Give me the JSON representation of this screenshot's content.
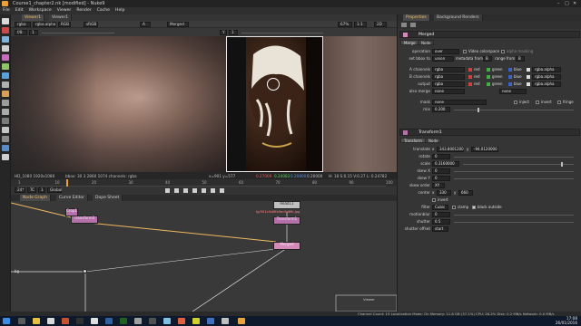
{
  "window": {
    "title": "Course1_chapter2.nk [modified] - Nuke9",
    "controls": [
      "–",
      "□",
      "✕"
    ]
  },
  "menu": [
    "File",
    "Edit",
    "Workspace",
    "Viewer",
    "Render",
    "Cache",
    "Help"
  ],
  "viewer": {
    "tabs": [
      "Viewer1",
      "Viewer1"
    ],
    "toolbar": {
      "channels": "rgba",
      "layer": "rgba.alpha",
      "display": "RGB",
      "lut": "sRGB",
      "input_a": "A",
      "input_b": "Merged",
      "zoom": "67%",
      "proxy": "1:1",
      "mode": "2D"
    },
    "toolbar2": {
      "exposure_f": "f/8",
      "exposure_val": "1",
      "gamma_y": "Y",
      "gamma_val": "1"
    },
    "info": {
      "format": "HD_1080  1920x1080",
      "bbox": "bbox: 30 3 2860 1074 channels: rgba",
      "coords": "x=901 y=577",
      "values": [
        "0.27009",
        "0.24083",
        "0.20800",
        "0.20000"
      ],
      "hsvl": "H: 18 S:0.15 V:0.27  L: 0.24782"
    },
    "timeline": {
      "ticks": [
        "1",
        "10",
        "20",
        "30",
        "40",
        "50",
        "60",
        "70",
        "80",
        "90",
        "100"
      ],
      "fps": "24*",
      "mode": "TC",
      "frame": "1",
      "scope": "Global",
      "playback_progress": 0.13
    }
  },
  "nodegraph": {
    "tabs": [
      "Node Graph",
      "Curve Editor",
      "Dope Sheet"
    ],
    "nodes": [
      {
        "name": "Read11",
        "file": "fg/501c0s6ffa9ec9d6fb.jpg",
        "color": "#c0c0c0"
      },
      {
        "name": "Transform1",
        "color": "#b470a8"
      },
      {
        "name": "Transform3",
        "color": "#b470a8"
      },
      {
        "name": "Merged",
        "color": "#d48ab8"
      },
      {
        "name": "Crop1",
        "color": "#b470a8"
      },
      {
        "name": "bg",
        "color": "#9a9a9a"
      },
      {
        "name": "Viewer",
        "color": "#888888"
      }
    ]
  },
  "properties": {
    "tabs": [
      "Properties",
      "Background Renders"
    ],
    "merged": {
      "name": "Merged",
      "subtabs": [
        "Merge",
        "Node"
      ],
      "operation_label": "operation",
      "operation": "over",
      "video_colorspace": "Video colorspace",
      "alpha_masking": "alpha masking",
      "set_bbox_label": "set bbox to",
      "set_bbox": "union",
      "metadata_label": "metadata from",
      "metadata": "B",
      "range_label": "range from",
      "range": "B",
      "a_channels_label": "A channels",
      "a_channels": "rgba",
      "b_channels_label": "B channels",
      "b_channels": "rgba",
      "output_label": "output",
      "output": "rgba",
      "also_merge_label": "also merge",
      "also_merge": "none",
      "chan_labels": [
        "red",
        "green",
        "blue",
        "rgba.alpha"
      ],
      "also_merge_none": "none",
      "mask_label": "mask",
      "mask": "none",
      "inject": "inject",
      "invert": "invert",
      "fringe": "fringe",
      "mix_label": "mix",
      "mix": "0.200"
    },
    "transform": {
      "name": "Transform1",
      "subtabs": [
        "Transform",
        "Node"
      ],
      "translate_label": "translate",
      "translate_x": "343.8001200",
      "translate_y": "-94.0120000",
      "rotate_label": "rotate",
      "rotate": "0",
      "scale_label": "scale",
      "scale": "0.3160000",
      "skew_x_label": "skew X",
      "skew_x": "0",
      "skew_y_label": "skew Y",
      "skew_y": "0",
      "skew_order_label": "skew order",
      "skew_order": "XY",
      "center_label": "center",
      "center_x": "330",
      "center_y": "660",
      "invert_label": "invert",
      "filter_label": "filter",
      "filter": "Cubic",
      "clamp": "clamp",
      "black_outside": "black outside",
      "motionblur_label": "motionblur",
      "motionblur": "0",
      "shutter_label": "shutter",
      "shutter": "0.5",
      "shutter_offset_label": "shutter offset",
      "shutter_offset": "start"
    }
  },
  "statusbar": "Channel Count: 19  Localization Mode: On  Memory: 11.8 GB (37.1%)  CPU: 26.2%  Disk: 0.2 MB/s  Network: 0.0 MB/s",
  "taskbar": {
    "time": "17:08",
    "date": "26/01/2016"
  },
  "colors": {
    "accent": "#f0a030",
    "node_pink": "#b470a8",
    "read_node": "#c0c0c0"
  }
}
